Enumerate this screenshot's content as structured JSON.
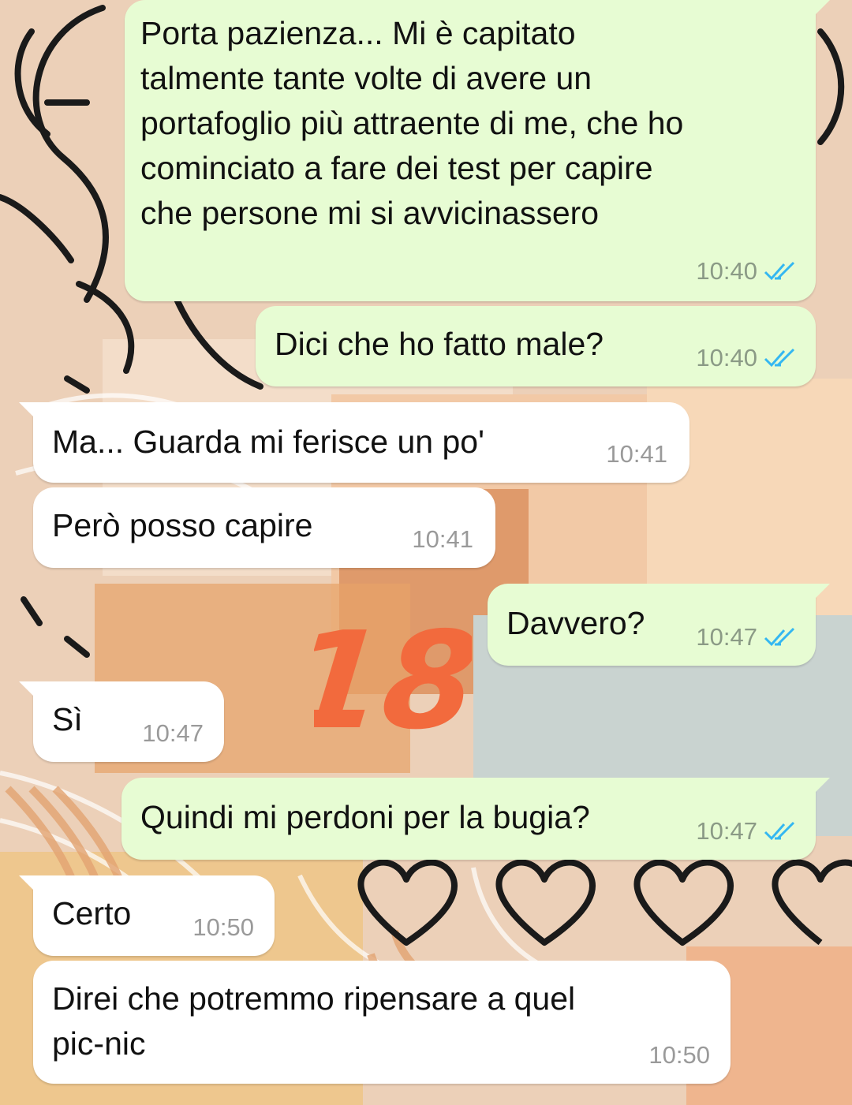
{
  "wallpaper": {
    "colors": [
      "#e9c4a6",
      "#f3dcc8",
      "#d9a07a",
      "#c8d4d2",
      "#f0a060",
      "#1a1a1a"
    ]
  },
  "accent": {
    "read_receipt": "#34b7f1",
    "sticker": "#f26a3d"
  },
  "messages": [
    {
      "direction": "outgoing",
      "lines": [
        "Porta pazienza... Mi è capitato",
        "talmente tante volte di avere un",
        "portafoglio più attraente di me, che ho",
        "cominciato a fare dei test per capire",
        "che persone mi si avvicinassero"
      ],
      "time": "10:40",
      "status": "read"
    },
    {
      "direction": "outgoing",
      "lines": [
        "Dici che ho fatto male?"
      ],
      "time": "10:40",
      "status": "read"
    },
    {
      "direction": "incoming",
      "lines": [
        "Ma... Guarda mi ferisce un po'"
      ],
      "time": "10:41"
    },
    {
      "direction": "incoming",
      "lines": [
        "Però posso capire"
      ],
      "time": "10:41"
    },
    {
      "direction": "outgoing",
      "lines": [
        "Davvero?"
      ],
      "time": "10:47",
      "status": "read"
    },
    {
      "direction": "incoming",
      "lines": [
        "Sì"
      ],
      "time": "10:47"
    },
    {
      "direction": "outgoing",
      "lines": [
        "Quindi mi perdoni per la bugia?"
      ],
      "time": "10:47",
      "status": "read"
    },
    {
      "direction": "incoming",
      "lines": [
        "Certo"
      ],
      "time": "10:50"
    },
    {
      "direction": "incoming",
      "lines": [
        "Direi che potremmo ripensare a quel",
        "pic-nic"
      ],
      "time": "10:50"
    }
  ],
  "sticker": {
    "text": "18"
  }
}
